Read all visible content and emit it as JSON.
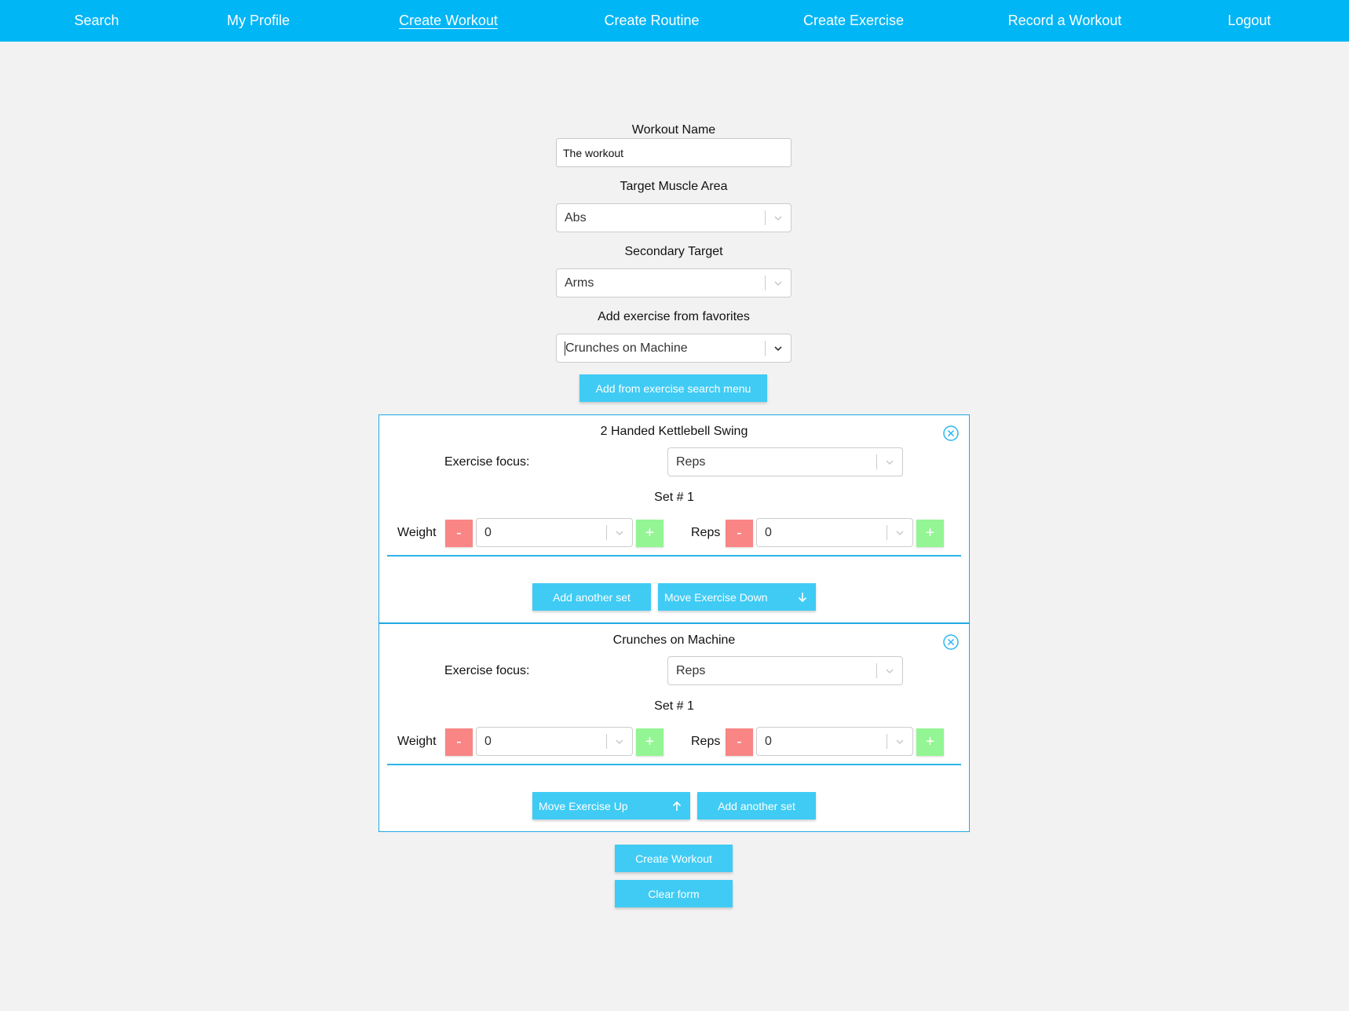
{
  "nav": {
    "items": [
      "Search",
      "My Profile",
      "Create Workout",
      "Create Routine",
      "Create Exercise",
      "Record a Workout",
      "Logout"
    ],
    "active": "Create Workout"
  },
  "form": {
    "workout_name_label": "Workout Name",
    "workout_name_value": "The workout",
    "target_label": "Target Muscle Area",
    "target_value": "Abs",
    "secondary_label": "Secondary Target",
    "secondary_value": "Arms",
    "favorites_label": "Add exercise from favorites",
    "favorites_value": "Crunches on Machine",
    "search_menu_button": "Add from exercise search menu"
  },
  "exercises": [
    {
      "name": "2 Handed Kettlebell Swing",
      "focus_label": "Exercise focus:",
      "focus_value": "Reps",
      "set_label": "Set # 1",
      "weight_label": "Weight",
      "weight_value": "0",
      "reps_label": "Reps",
      "reps_value": "0",
      "minus_label": "-",
      "plus_label": "+",
      "buttons": [
        "Add another set",
        "Move Exercise Down"
      ]
    },
    {
      "name": "Crunches on Machine",
      "focus_label": "Exercise focus:",
      "focus_value": "Reps",
      "set_label": "Set # 1",
      "weight_label": "Weight",
      "weight_value": "0",
      "reps_label": "Reps",
      "reps_value": "0",
      "minus_label": "-",
      "plus_label": "+",
      "buttons": [
        "Move Exercise Up",
        "Add another set"
      ]
    }
  ],
  "actions": {
    "create": "Create Workout",
    "clear": "Clear form"
  },
  "icons": {
    "select_arrow": "chevron-down-icon",
    "close": "close-circle-icon",
    "move_down": "arrow-down-icon",
    "move_up": "arrow-up-icon"
  },
  "colors": {
    "nav_bg": "#00b6f5",
    "button": "#3fcbf4",
    "card_border": "#1fa9e1",
    "minus": "#f98585",
    "plus": "#93f593",
    "page_bg": "#f2f2f2"
  }
}
